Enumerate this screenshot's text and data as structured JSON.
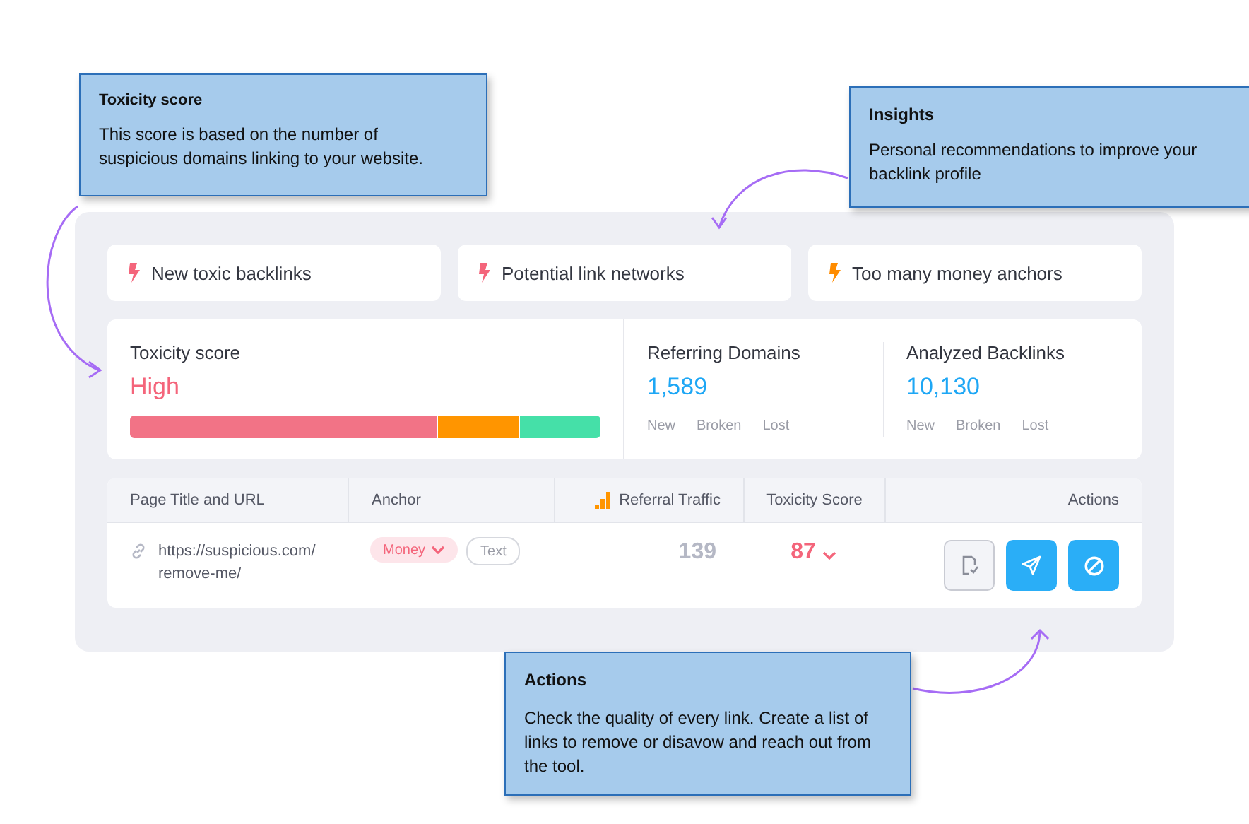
{
  "callouts": [
    {
      "title": "Toxicity score",
      "text": "This score is based on the number of suspicious domains linking to your website."
    },
    {
      "title": "Insights",
      "text": "Personal recommendations to improve your backlink profile"
    },
    {
      "title": "Actions",
      "text": "Check the quality of every link. Create a list of links to remove or disavow and reach out from the tool."
    }
  ],
  "insights": [
    {
      "label": "New toxic backlinks",
      "color": "#f4657b"
    },
    {
      "label": "Potential link networks",
      "color": "#f4657b"
    },
    {
      "label": "Too many money anchors",
      "color": "#ff8c00"
    }
  ],
  "toxicity": {
    "label": "Toxicity score",
    "value": "High"
  },
  "stats": [
    {
      "label": "Referring Domains",
      "value": "1,589",
      "links": [
        "New",
        "Broken",
        "Lost"
      ]
    },
    {
      "label": "Analyzed Backlinks",
      "value": "10,130",
      "links": [
        "New",
        "Broken",
        "Lost"
      ]
    }
  ],
  "table": {
    "columns": [
      "Page Title and URL",
      "Anchor",
      "Referral Traffic",
      "Toxicity Score",
      "Actions"
    ],
    "rows": [
      {
        "url": "https://suspicious.com/ remove-me/",
        "anchors": [
          {
            "label": "Money",
            "kind": "money"
          },
          {
            "label": "Text",
            "kind": "text"
          }
        ],
        "traffic": "139",
        "score": "87",
        "actions": [
          {
            "kind": "review"
          },
          {
            "kind": "send"
          },
          {
            "kind": "block"
          }
        ]
      }
    ]
  }
}
